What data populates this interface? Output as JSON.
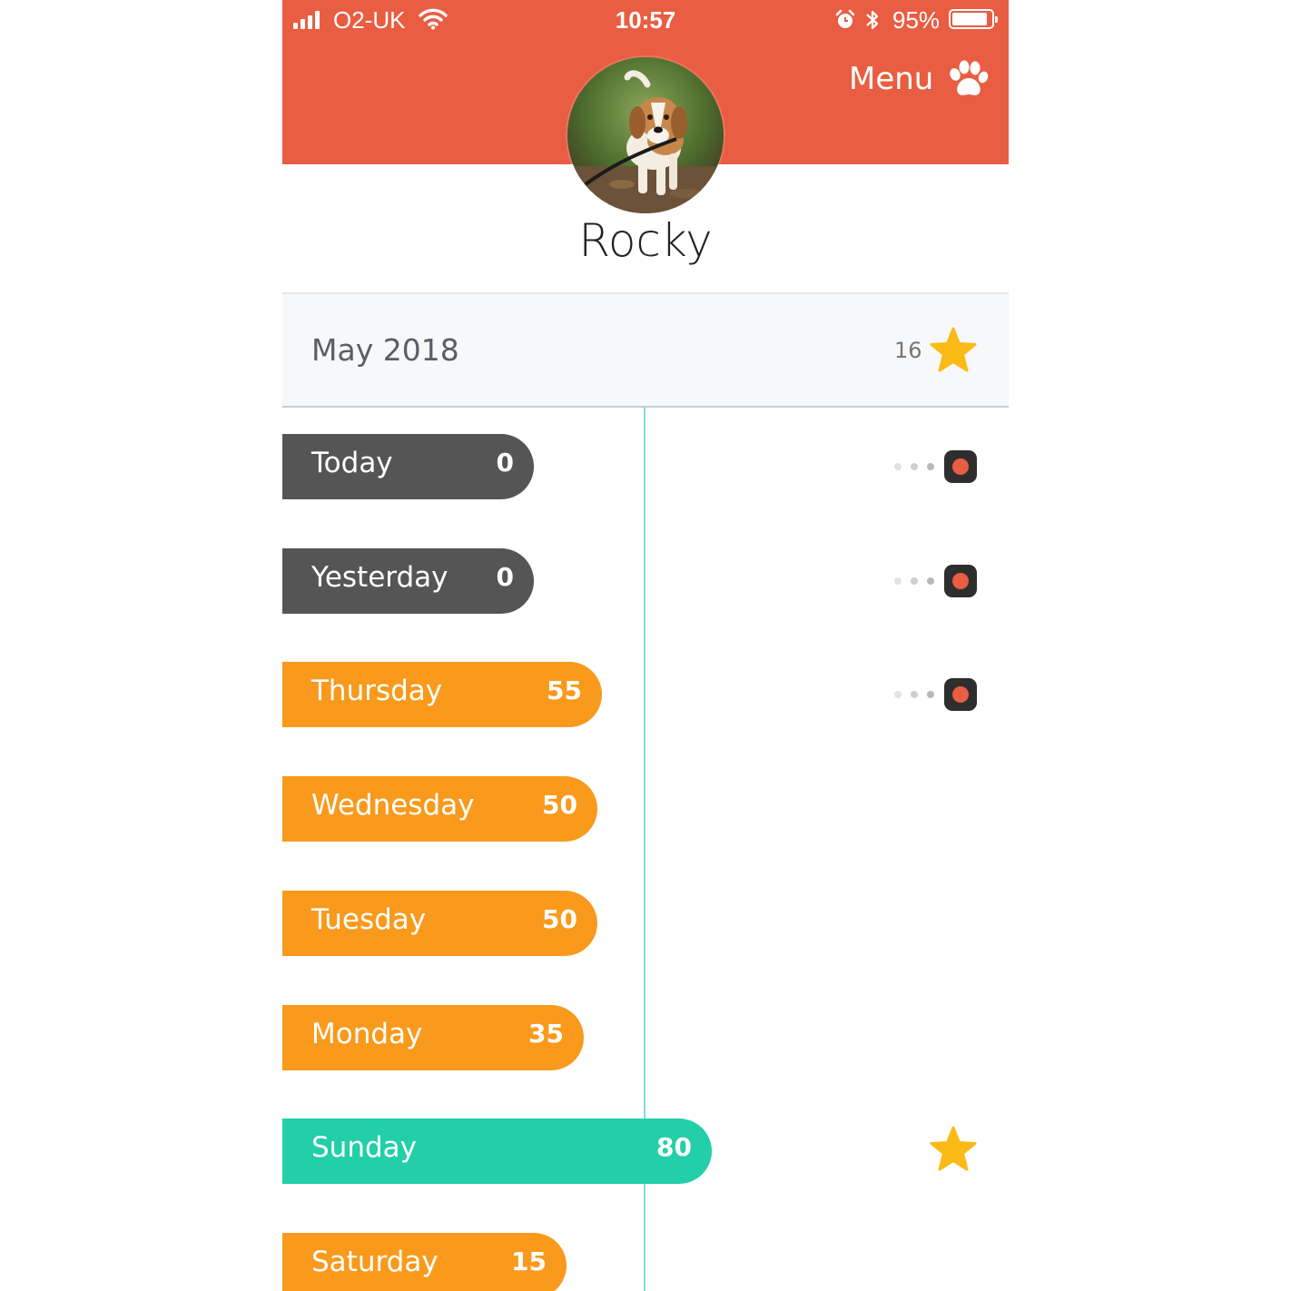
{
  "status_bar": {
    "carrier": "O2-UK",
    "time": "10:57",
    "battery_percent_text": "95%",
    "battery_level": 0.95,
    "icons": [
      "signal-icon",
      "wifi-icon",
      "alarm-icon",
      "bluetooth-icon",
      "battery-icon"
    ]
  },
  "header": {
    "menu_label": "Menu",
    "menu_icon": "paw-icon",
    "color": "#E95D42"
  },
  "profile": {
    "name": "Rocky",
    "avatar": "beagle-photo"
  },
  "month": {
    "label": "May 2018",
    "star_count": "16",
    "icon": "star-icon"
  },
  "days": [
    {
      "label": "Today",
      "value": "0",
      "score": 0,
      "style": "gray",
      "record": true,
      "star": false
    },
    {
      "label": "Yesterday",
      "value": "0",
      "score": 0,
      "style": "gray",
      "record": true,
      "star": false
    },
    {
      "label": "Thursday",
      "value": "55",
      "score": 55,
      "style": "orange",
      "record": true,
      "star": false
    },
    {
      "label": "Wednesday",
      "value": "50",
      "score": 50,
      "style": "orange",
      "record": false,
      "star": false
    },
    {
      "label": "Tuesday",
      "value": "50",
      "score": 50,
      "style": "orange",
      "record": false,
      "star": false
    },
    {
      "label": "Monday",
      "value": "35",
      "score": 35,
      "style": "orange",
      "record": false,
      "star": false
    },
    {
      "label": "Sunday",
      "value": "80",
      "score": 80,
      "style": "teal",
      "record": false,
      "star": true
    },
    {
      "label": "Saturday",
      "value": "15",
      "score": 15,
      "style": "orange",
      "record": false,
      "star": false
    }
  ],
  "colors": {
    "header": "#E95D42",
    "gray_pill": "#555555",
    "orange_pill": "#F99A1C",
    "teal_pill": "#22CFA8",
    "timeline": "#7FDCD6",
    "star": "#FBBA16"
  }
}
